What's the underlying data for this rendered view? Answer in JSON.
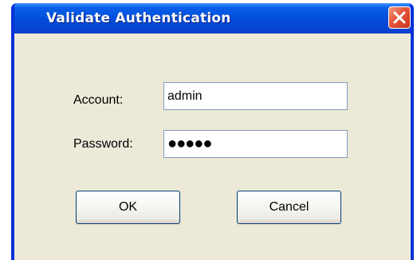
{
  "window": {
    "title": "Validate Authentication",
    "close_icon": "close-icon",
    "accent_color": "#0453e0",
    "close_color": "#e3553b"
  },
  "form": {
    "account_label": "Account:",
    "account_value": "admin",
    "password_label": "Password:",
    "password_value": "●●●●●"
  },
  "buttons": {
    "ok_label": "OK",
    "cancel_label": "Cancel"
  }
}
